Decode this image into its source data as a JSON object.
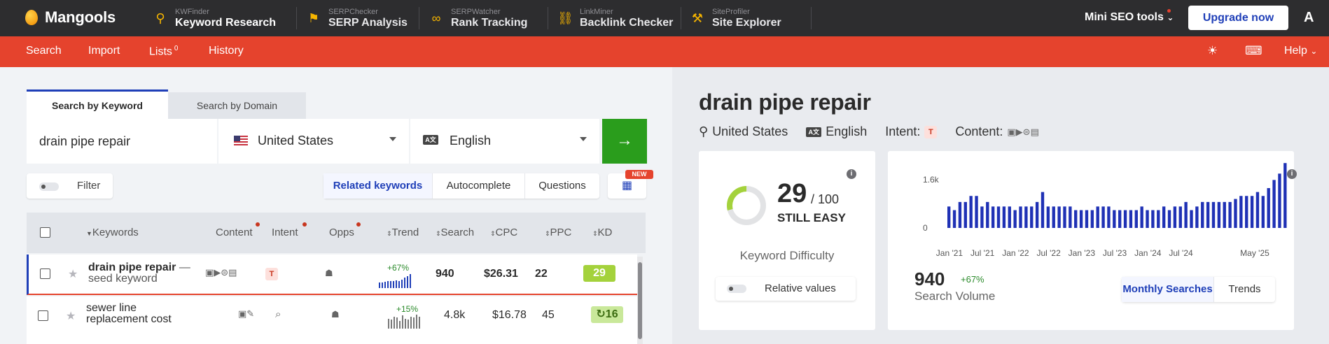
{
  "brand": {
    "name": "Mangools"
  },
  "apps": [
    {
      "sub": "KWFinder",
      "main": "Keyword Research",
      "icon": "wand-icon",
      "glyph": "⚲",
      "active": true
    },
    {
      "sub": "SERPChecker",
      "main": "SERP Analysis",
      "icon": "location-pin-icon",
      "glyph": "⚑"
    },
    {
      "sub": "SERPWatcher",
      "main": "Rank Tracking",
      "icon": "glasses-icon",
      "glyph": "∞"
    },
    {
      "sub": "LinkMiner",
      "main": "Backlink Checker",
      "icon": "link-icon",
      "glyph": "⛓"
    },
    {
      "sub": "SiteProfiler",
      "main": "Site Explorer",
      "icon": "hammer-icon",
      "glyph": "⚒"
    }
  ],
  "header_right": {
    "mini_tools": "Mini SEO tools",
    "upgrade": "Upgrade now",
    "avatar": "A"
  },
  "subnav": {
    "search": "Search",
    "import": "Import",
    "lists": "Lists",
    "lists_count": "0",
    "history": "History",
    "help": "Help"
  },
  "search": {
    "tab_keyword": "Search by Keyword",
    "tab_domain": "Search by Domain",
    "keyword": "drain pipe repair",
    "location": "United States",
    "language": "English",
    "lang_code": "A文"
  },
  "toolbar": {
    "filter": "Filter",
    "tabs": [
      "Related keywords",
      "Autocomplete",
      "Questions"
    ],
    "new_badge": "NEW"
  },
  "table": {
    "headers": {
      "keywords": "Keywords",
      "content": "Content",
      "intent": "Intent",
      "opps": "Opps",
      "trend": "Trend",
      "search": "Search",
      "cpc": "CPC",
      "ppc": "PPC",
      "kd": "KD"
    },
    "rows": [
      {
        "keyword": "drain pipe repair",
        "sub": "seed keyword",
        "intent": "T",
        "trend": "+67%",
        "search": "940",
        "cpc": "$26.31",
        "ppc": "22",
        "kd": "29",
        "kd_color": "#a4d23c"
      },
      {
        "keyword_line1": "sewer line",
        "keyword_line2": "replacement cost",
        "trend": "+15%",
        "search": "4.8k",
        "cpc": "$16.78",
        "ppc": "45",
        "kd": "16",
        "kd_color": "#c9e89a"
      }
    ]
  },
  "overview": {
    "keyword": "drain pipe repair",
    "location": "United States",
    "language": "English",
    "intent_label": "Intent:",
    "intent": "T",
    "content_label": "Content:",
    "kd_value": "29",
    "kd_max": "/ 100",
    "kd_text": "STILL EASY",
    "kd_title": "Keyword Difficulty",
    "kd_score": 29,
    "relative_values": "Relative values",
    "search_volume": "940",
    "search_volume_change": "+67%",
    "search_volume_label": "Search Volume",
    "chart_tabs": [
      "Monthly Searches",
      "Trends"
    ]
  },
  "chart_data": {
    "type": "bar",
    "title": "",
    "xlabel": "",
    "ylabel": "",
    "ylim": [
      0,
      1900
    ],
    "yticks": [
      "0",
      "1.6k"
    ],
    "xticks": [
      "Jan '21",
      "Jul '21",
      "Jan '22",
      "Jul '22",
      "Jan '23",
      "Jul '23",
      "Jan '24",
      "Jul '24",
      "May '25"
    ],
    "series": [
      {
        "values": [
          710,
          590,
          860,
          860,
          1060,
          1060,
          710,
          860,
          710,
          710,
          710,
          710,
          590,
          710,
          710,
          710,
          860,
          1190,
          710,
          710,
          710,
          710,
          710,
          590,
          590,
          590,
          590,
          710,
          710,
          710,
          590,
          590,
          590,
          590,
          590,
          710,
          590,
          590,
          590,
          710,
          590,
          710,
          710,
          860,
          590,
          710,
          860,
          860,
          860,
          860,
          860,
          860,
          960,
          1060,
          1060,
          1060,
          1190,
          1060,
          1320,
          1590,
          1800,
          2150
        ]
      }
    ],
    "color": "#1f31b5"
  },
  "colors": {
    "accent": "#1f3fb8",
    "brand_red": "#e5432d",
    "go_green": "#2a9d1c",
    "kd_easy": "#a4d23c"
  }
}
